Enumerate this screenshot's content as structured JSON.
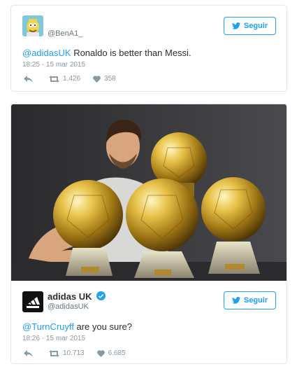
{
  "tweet1": {
    "handle": "@BenA1_",
    "follow_label": "Seguir",
    "mention": "@adidasUK",
    "text": " Ronaldo is better than Messi.",
    "timestamp": "18:25 - 15 mar 2015",
    "retweets": "1.426",
    "likes": "358",
    "icons": {
      "reply": "reply-icon",
      "retweet": "retweet-icon",
      "like": "heart-icon",
      "follow": "bird-icon"
    }
  },
  "tweet2": {
    "name": "adidas UK",
    "handle": "@adidasUK",
    "follow_label": "Seguir",
    "mention": "@TurnCruyff",
    "text": " are you sure?",
    "timestamp": "18:26 - 15 mar 2015",
    "retweets": "10.713",
    "likes": "6.685",
    "icons": {
      "reply": "reply-icon",
      "retweet": "retweet-icon",
      "like": "heart-icon",
      "verified": "verified-badge-icon",
      "follow": "bird-icon"
    }
  },
  "colors": {
    "link": "#1da1f2",
    "muted": "#8899a6",
    "border": "#e1e8ed",
    "text": "#292f33"
  }
}
